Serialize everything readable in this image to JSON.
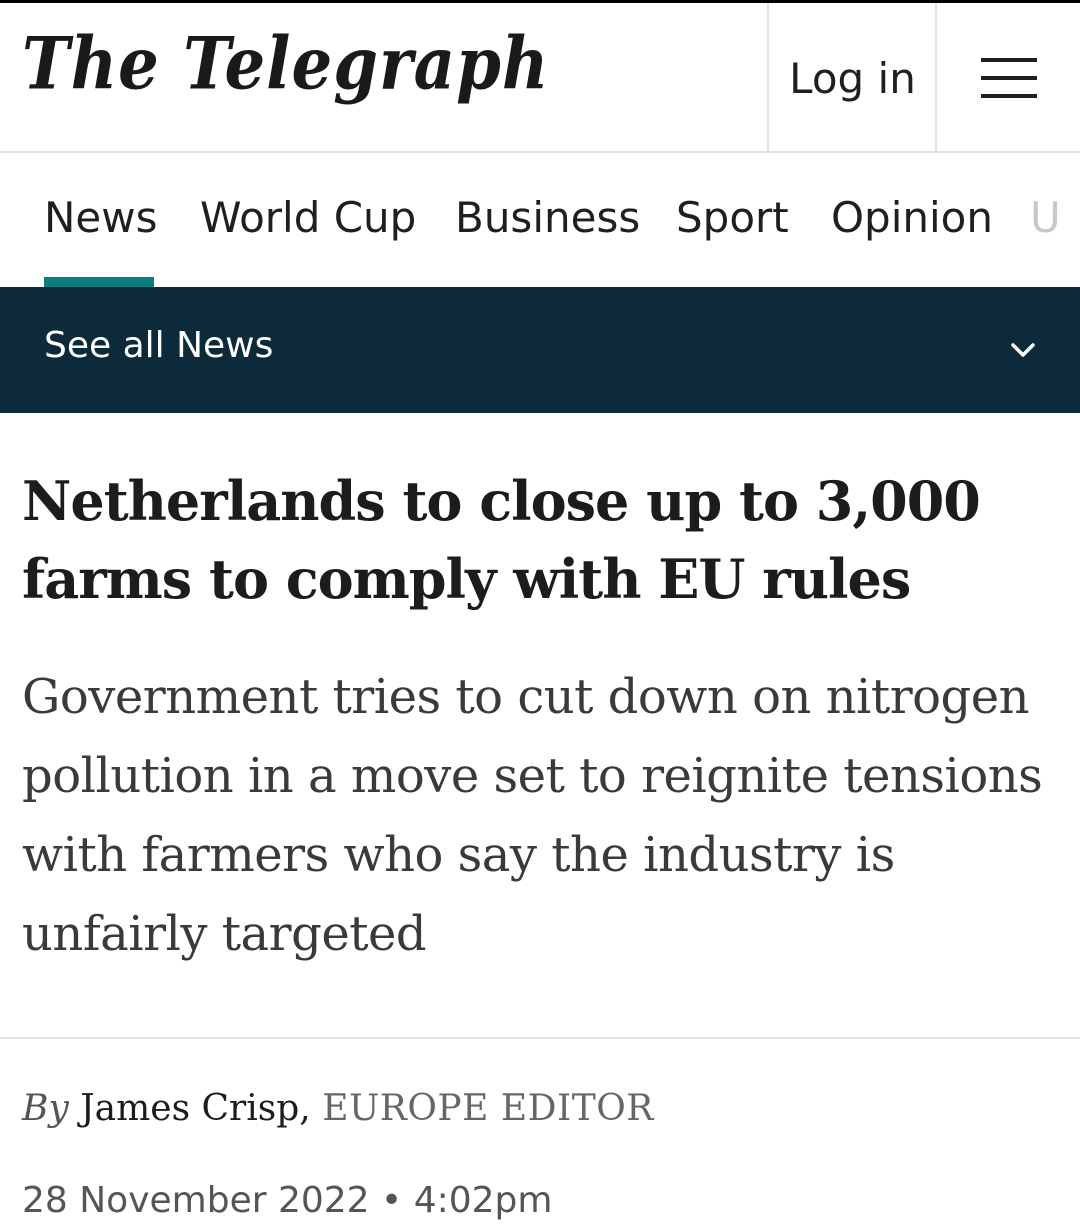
{
  "header": {
    "logo_text": "The Telegraph",
    "login_label": "Log in",
    "menu_icon": "hamburger-menu-icon"
  },
  "nav": {
    "tabs": [
      {
        "label": "News",
        "active": true
      },
      {
        "label": "World Cup",
        "active": false
      },
      {
        "label": "Business",
        "active": false
      },
      {
        "label": "Sport",
        "active": false
      },
      {
        "label": "Opinion",
        "active": false
      }
    ],
    "overflow_hint": "U",
    "accent_color": "#0d7c7c"
  },
  "section_bar": {
    "label": "See all News",
    "icon": "chevron-down-icon",
    "background": "#0c2a3a"
  },
  "article": {
    "headline": "Netherlands to close up to 3,000 farms to comply with EU rules",
    "standfirst": "Government tries to cut down on nitrogen pollution in a move set to reignite tensions with farmers who say the industry is unfairly targeted",
    "byline": {
      "by": "By",
      "author": "James Crisp,",
      "role": "EUROPE EDITOR"
    },
    "date": "28 November 2022 • 4:02pm"
  }
}
